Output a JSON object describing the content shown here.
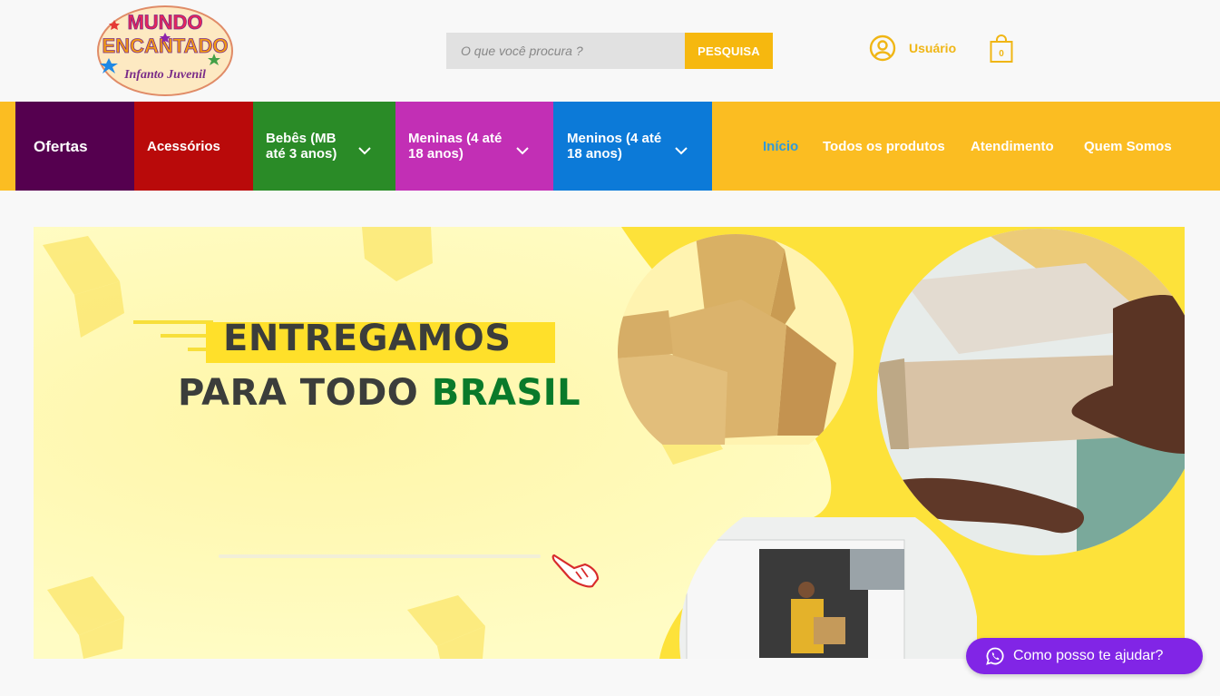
{
  "logo": {
    "line1": "MUNDO",
    "line2": "ENCANTADO",
    "line3": "Infanto Juvenil"
  },
  "search": {
    "placeholder": "O que você procura ?",
    "button_label": "PESQUISA"
  },
  "user": {
    "label": "Usuário",
    "icon": "user-circle-icon"
  },
  "cart": {
    "count": "0",
    "icon": "shopping-bag-icon"
  },
  "categories": [
    {
      "label": "Ofertas",
      "color": "#55004f"
    },
    {
      "label": "Acessórios",
      "color": "#b90a0a"
    },
    {
      "label": "Bebês (MB até 3 anos)",
      "line1": "Bebês (MB",
      "line2": "até 3 anos)",
      "color": "#2a8b27",
      "dropdown": true
    },
    {
      "label": "Meninas (4 até 18 anos)",
      "line1": "Meninas (4 até",
      "line2": "18 anos)",
      "color": "#c22fb5",
      "dropdown": true
    },
    {
      "label": "Meninos (4 até 18 anos)",
      "line1": "Meninos (4 até",
      "line2": "18 anos)",
      "color": "#0c7ad8",
      "dropdown": true
    }
  ],
  "main_nav": [
    {
      "label": "Início",
      "active": true
    },
    {
      "label": "Todos os produtos"
    },
    {
      "label": "Atendimento"
    },
    {
      "label": "Quem Somos"
    }
  ],
  "banner": {
    "headline1": "ENTREGAMOS",
    "headline2_prefix": "PARA TODO",
    "headline2_highlight": "BRASIL"
  },
  "whatsapp": {
    "label": "Como posso te ajudar?",
    "icon": "whatsapp-icon"
  },
  "colors": {
    "nav_bg": "#fbbd22",
    "accent": "#f6b80f",
    "headline": "#3b3d3b",
    "highlight": "#0a7a2a",
    "whatsapp": "#8125e6",
    "active_link": "#2f9ad9"
  }
}
